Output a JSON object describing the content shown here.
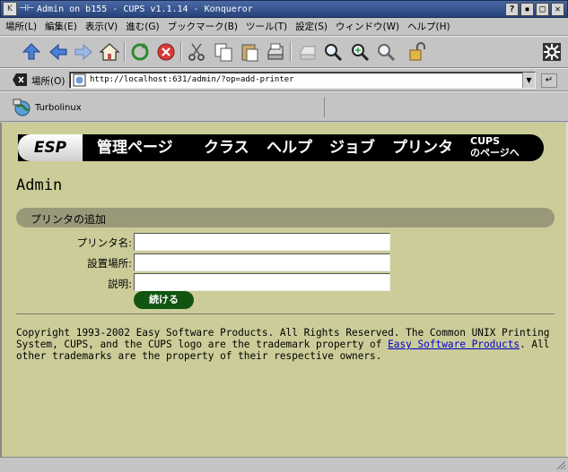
{
  "window": {
    "title": "Admin on b155 - CUPS v1.1.14 - Konqueror",
    "pin_glyph": "⊣⊢",
    "help_button": "?",
    "minimize_button": "▪",
    "maximize_button": "□",
    "close_button": "✕"
  },
  "menubar": {
    "items": [
      "場所(L)",
      "編集(E)",
      "表示(V)",
      "進む(G)",
      "ブックマーク(B)",
      "ツール(T)",
      "設定(S)",
      "ウィンドウ(W)",
      "ヘルプ(H)"
    ]
  },
  "toolbar": {
    "buttons": [
      "up-icon",
      "back-icon",
      "forward-icon",
      "home-icon",
      "reload-icon",
      "stop-icon",
      "cut-icon",
      "copy-icon",
      "paste-icon",
      "print-icon",
      "print-frame-icon",
      "zoom-icon",
      "zoom-in-icon",
      "zoom-out-icon",
      "security-lock-icon"
    ]
  },
  "location": {
    "label": "場所(O)",
    "url": "http://localhost:631/admin/?op=add-printer"
  },
  "bookmarks": {
    "items": [
      {
        "label": "Turbolinux"
      }
    ]
  },
  "banner": {
    "esp": "ESP",
    "nav": [
      "管理ページ",
      "クラス",
      "ヘルプ",
      "ジョブ",
      "プリンタ"
    ],
    "cups_line1": "CUPS",
    "cups_line2": "のページへ"
  },
  "page": {
    "title": "Admin",
    "section": "プリンタの追加",
    "fields": [
      {
        "label": "プリンタ名:",
        "value": ""
      },
      {
        "label": "設置場所:",
        "value": ""
      },
      {
        "label": "説明:",
        "value": ""
      }
    ],
    "continue_label": "続ける"
  },
  "footer": {
    "text_before": "Copyright 1993-2002 Easy Software Products. All Rights Reserved. The Common UNIX Printing System, CUPS, and the CUPS logo are the trademark property of ",
    "link": "Easy Software Products",
    "text_after": ". All other trademarks are the property of their respective owners."
  },
  "colors": {
    "titlebar": "#26427a",
    "content_bg": "#cccc99",
    "section_bar": "#99997a",
    "button_green": "#115511",
    "link": "#0000cc"
  }
}
